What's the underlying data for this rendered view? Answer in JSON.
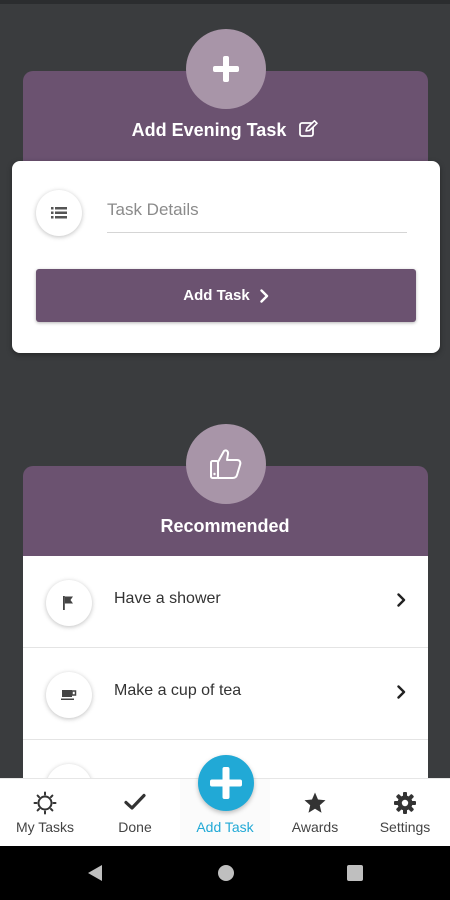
{
  "add_card": {
    "title": "Add Evening Task",
    "title_icon": "edit-icon",
    "badge_icon": "plus-icon",
    "input_placeholder": "Task Details",
    "input_value": "",
    "field_icon": "list-icon",
    "button_label": "Add Task",
    "button_icon": "chevron-right-icon"
  },
  "recommended": {
    "title": "Recommended",
    "badge_icon": "thumbs-up-icon",
    "items": [
      {
        "label": "Have a shower",
        "icon": "flag-icon"
      },
      {
        "label": "Make a cup of tea",
        "icon": "cup-icon"
      },
      {
        "label": "",
        "icon": ""
      }
    ]
  },
  "bottom_nav": {
    "items": [
      {
        "label": "My Tasks",
        "icon": "sun-icon"
      },
      {
        "label": "Done",
        "icon": "check-icon"
      },
      {
        "label": "Add Task",
        "icon": "plus-circle-icon",
        "active": true
      },
      {
        "label": "Awards",
        "icon": "star-icon"
      },
      {
        "label": "Settings",
        "icon": "gear-icon"
      }
    ]
  },
  "colors": {
    "background": "#3a3c3e",
    "card_header": "#6b5270",
    "badge": "#a895a8",
    "accent": "#21a9d6"
  }
}
